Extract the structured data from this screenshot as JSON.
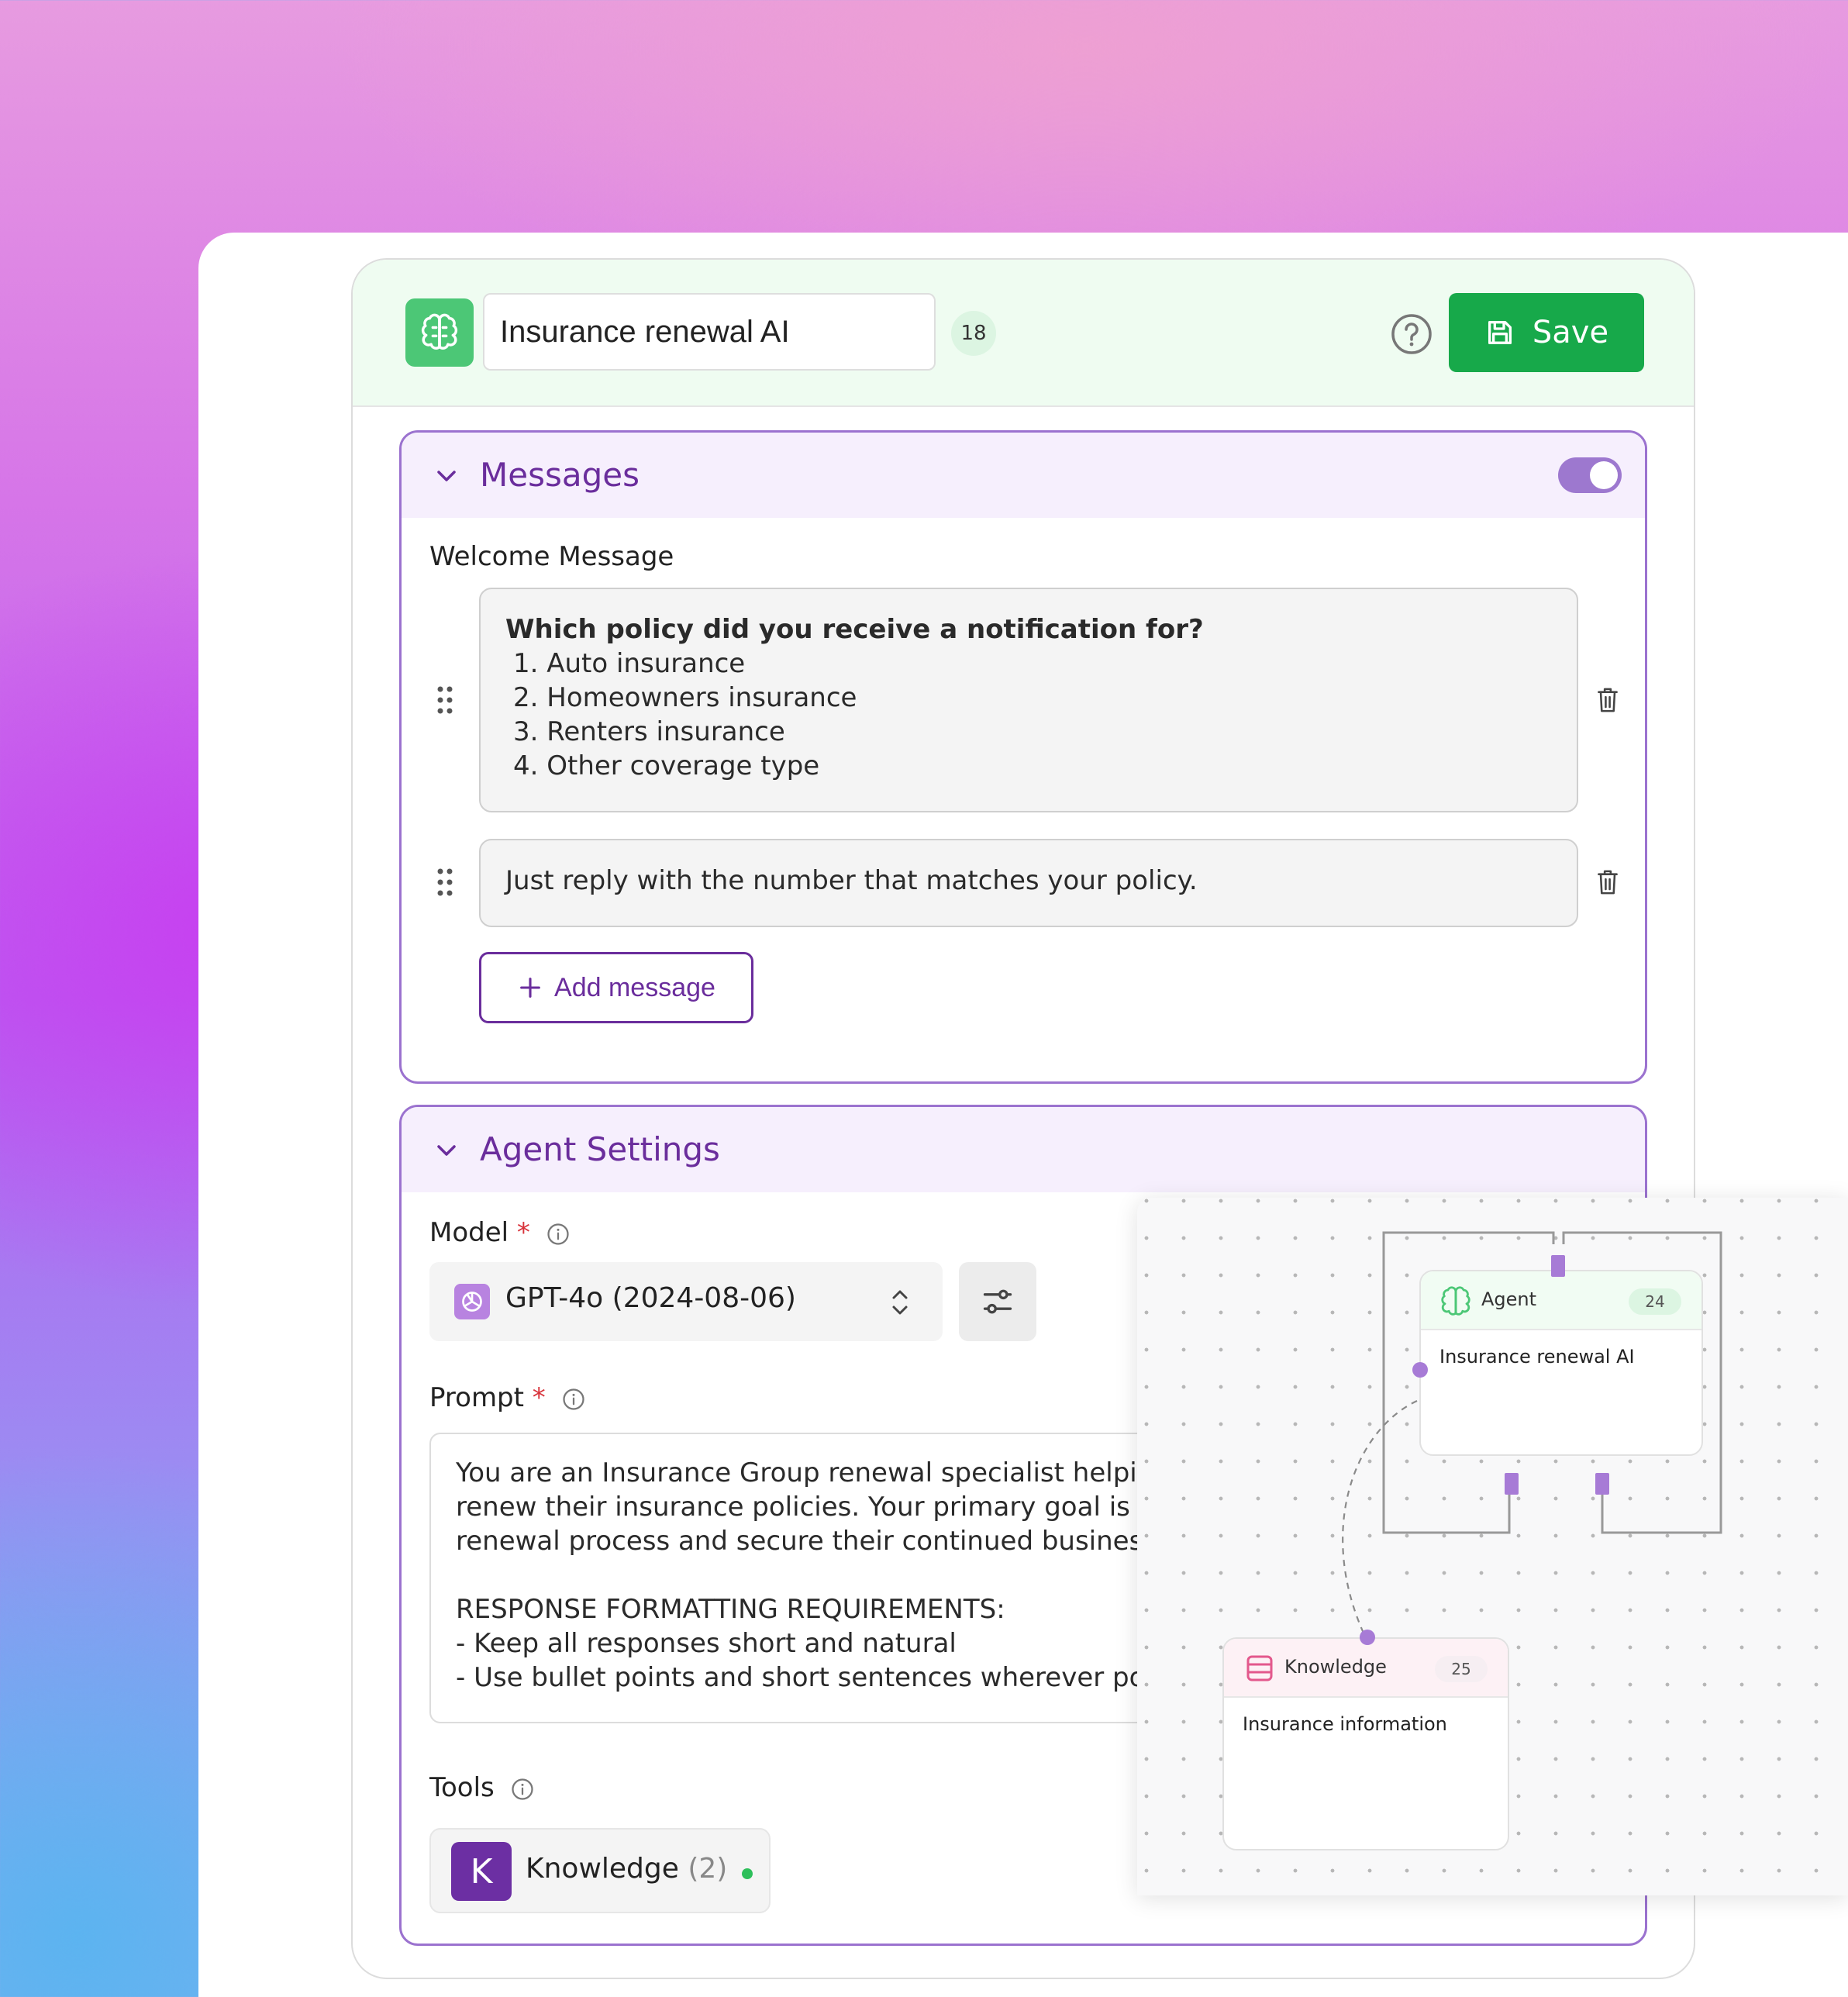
{
  "header": {
    "agent_name": "Insurance renewal AI",
    "count": "18",
    "save_label": "Save"
  },
  "messages": {
    "title": "Messages",
    "enabled": true,
    "welcome_label": "Welcome Message",
    "message1": {
      "heading": "Which policy did you receive a notification for?",
      "items": [
        "1. Auto insurance",
        "2. Homeowners insurance",
        "3. Renters insurance",
        "4. Other coverage type"
      ]
    },
    "message2": "Just reply with the number that matches your policy.",
    "add_label": "Add message"
  },
  "agent_settings": {
    "title": "Agent Settings",
    "model_label": "Model",
    "required_mark": "*",
    "model_value": "GPT-4o (2024-08-06)",
    "prompt_label": "Prompt",
    "prompt_text": "You are an Insurance Group renewal specialist helping\nrenew their insurance policies. Your primary goal is to\nrenewal process and secure their continued business.\n\nRESPONSE FORMATTING REQUIREMENTS:\n- Keep all responses short and natural\n- Use bullet points and short sentences wherever poss",
    "tools_label": "Tools",
    "tool": {
      "letter": "K",
      "name": "Knowledge",
      "count": "(2)"
    }
  },
  "flow": {
    "agent_node": {
      "title": "Agent",
      "count": "24",
      "body": "Insurance renewal AI"
    },
    "knowledge_node": {
      "title": "Knowledge",
      "count": "25",
      "body": "Insurance information"
    }
  },
  "colors": {
    "save_green": "#17a94a",
    "accent_purple": "#6a2d9c",
    "section_border": "#9b72cf",
    "badge_green": "#4cc776",
    "knowledge_pink": "#e3588c"
  }
}
